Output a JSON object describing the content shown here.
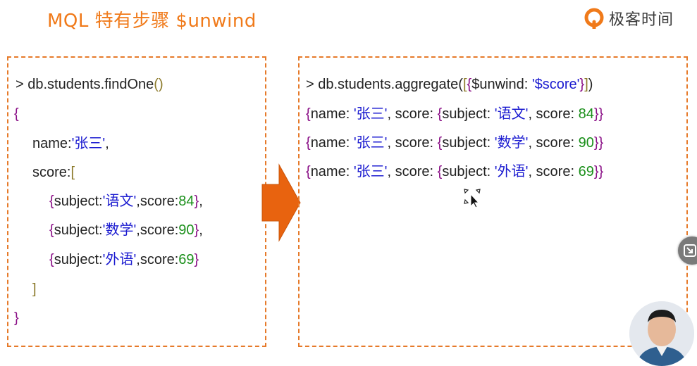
{
  "slide": {
    "title": "MQL 特有步骤 $unwind",
    "brand_name": "极客时间"
  },
  "left_panel": {
    "line1_prompt": "> db",
    "line1_dot": ".",
    "line1_coll": "students",
    "line1_dot2": ".",
    "line1_method": "findOne",
    "line1_paren": "()",
    "open_brace": "{",
    "name_key": "name:",
    "name_value": "'张三'",
    "comma": ",",
    "score_key": "score:",
    "score_bracket_open": "[",
    "items": [
      {
        "open": "{",
        "subject_key": "subject:",
        "subject_value": "'语文'",
        "score_key": ",score:",
        "score_value": "84",
        "close": "}",
        "trail": ","
      },
      {
        "open": "{",
        "subject_key": "subject:",
        "subject_value": "'数学'",
        "score_key": ",score:",
        "score_value": "90",
        "close": "}",
        "trail": ","
      },
      {
        "open": "{",
        "subject_key": "subject:",
        "subject_value": "'外语'",
        "score_key": ",score:",
        "score_value": "69",
        "close": "}",
        "trail": ""
      }
    ],
    "score_bracket_close": "]",
    "close_brace": "}"
  },
  "right_panel": {
    "command_prefix": "> db.students.aggregate(",
    "command_bracket_open": "[",
    "command_brace_open": "{",
    "command_key": "$unwind: ",
    "command_value": "'$score'",
    "command_brace_close": "}",
    "command_bracket_close": "]",
    "command_paren_close": ")",
    "results": [
      {
        "open": "{",
        "name_key": "name: ",
        "name_value": "'张三'",
        "mid": ", score: ",
        "inner_open": "{",
        "subject_key": "subject: ",
        "subject_value": "'语文'",
        "score_key": ", score: ",
        "score_value": "84",
        "inner_close": "}",
        "close": "}"
      },
      {
        "open": "{",
        "name_key": "name: ",
        "name_value": "'张三'",
        "mid": ", score: ",
        "inner_open": "{",
        "subject_key": "subject: ",
        "subject_value": "'数学'",
        "score_key": ", score: ",
        "score_value": "90",
        "inner_close": "}",
        "close": "}"
      },
      {
        "open": "{",
        "name_key": "name: ",
        "name_value": "'张三'",
        "mid": ", score: ",
        "inner_open": "{",
        "subject_key": "subject: ",
        "subject_value": "'外语'",
        "score_key": ", score: ",
        "score_value": "69",
        "inner_close": "}",
        "close": "}"
      }
    ]
  },
  "icons": {
    "arrow": "right-arrow-icon",
    "cursor": "move-cursor-icon",
    "side_button": "minimize-icon",
    "brand_logo": "geek-time-logo-icon"
  },
  "colors": {
    "title": "#f07a1a",
    "dashed_border": "#e67a2a",
    "arrow": "#e8630f",
    "string": "#1b1bd0",
    "number": "#1a8f1a",
    "brace": "#8a0f86"
  }
}
